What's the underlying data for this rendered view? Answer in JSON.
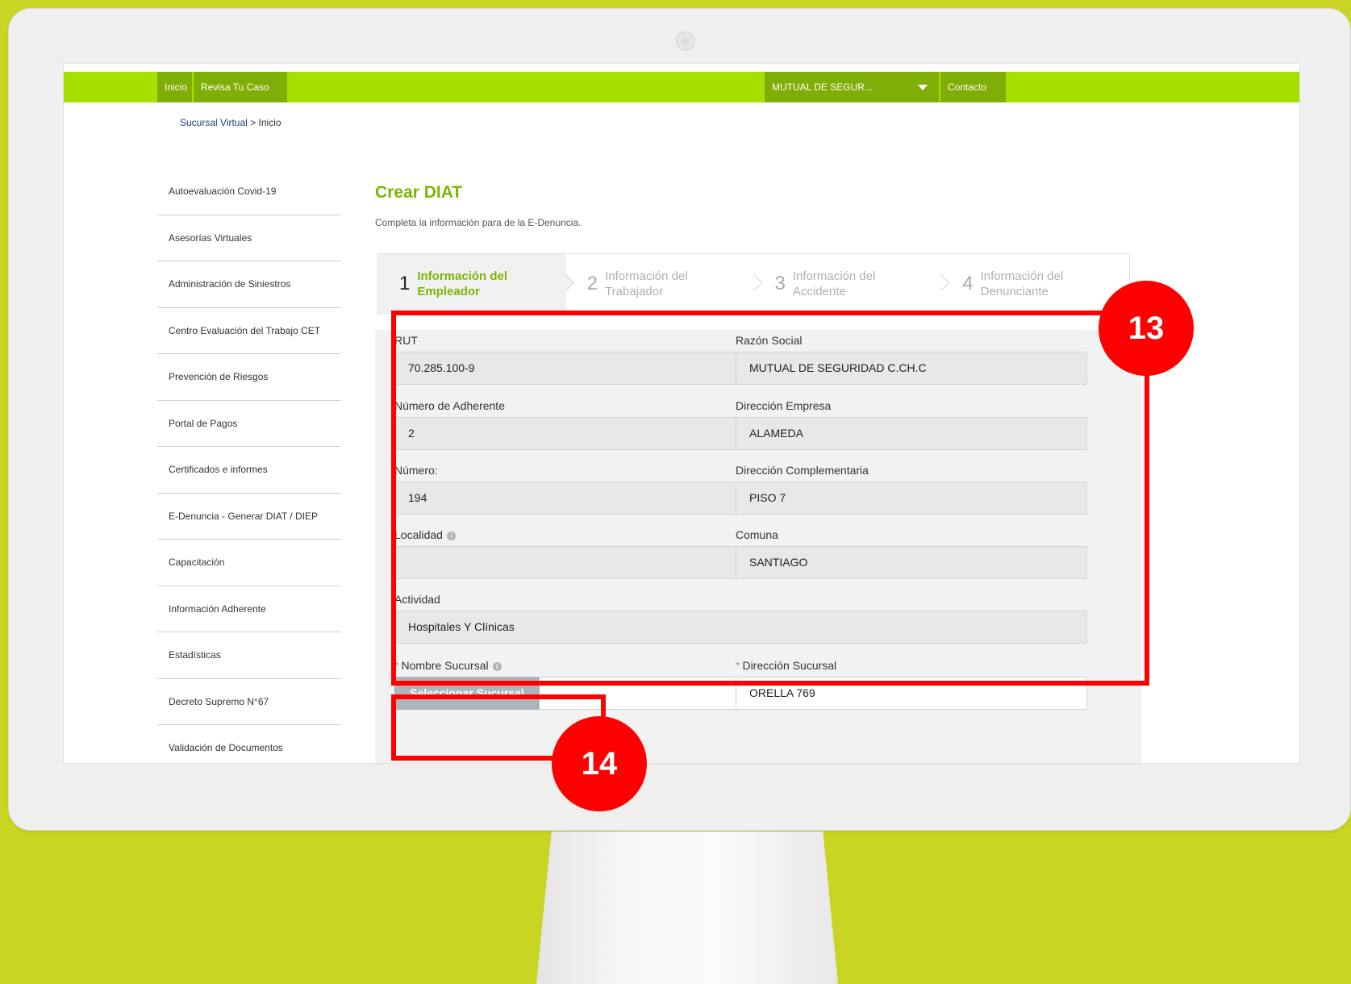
{
  "nav": {
    "inicio": "Inicio",
    "revisa": "Revisa Tu Caso",
    "company": "MUTUAL DE SEGUR...",
    "contacto": "Contacto"
  },
  "breadcrumb": {
    "link": "Sucursal Virtual",
    "separator": " > ",
    "current": "Inicio"
  },
  "sidebar": {
    "items": [
      {
        "label": "Autoevaluación Covid-19"
      },
      {
        "label": "Asesorías Virtuales"
      },
      {
        "label": "Administración de Siniestros"
      },
      {
        "label": "Centro Evaluación del Trabajo CET"
      },
      {
        "label": "Prevención de Riesgos"
      },
      {
        "label": "Portal de Pagos"
      },
      {
        "label": "Certificados e informes"
      },
      {
        "label": "E-Denuncia - Generar DIAT / DIEP"
      },
      {
        "label": "Capacitación"
      },
      {
        "label": "Información Adherente"
      },
      {
        "label": "Estadísticas"
      },
      {
        "label": "Decreto Supremo N°67"
      },
      {
        "label": "Validación de Documentos"
      }
    ]
  },
  "page": {
    "title": "Crear DIAT",
    "description": "Completa la información para de la E-Denuncia."
  },
  "steps": [
    {
      "num": "1",
      "label": "Información del Empleador"
    },
    {
      "num": "2",
      "label": "Información del Trabajador"
    },
    {
      "num": "3",
      "label": "Información del Accidente"
    },
    {
      "num": "4",
      "label": "Información del Denunciante"
    }
  ],
  "form": {
    "rut": {
      "label": "RUT",
      "value": "70.285.100-9"
    },
    "razon_social": {
      "label": "Razón Social",
      "value": "MUTUAL DE SEGURIDAD C.CH.C"
    },
    "num_adherente": {
      "label": "Número de Adherente",
      "value": "2"
    },
    "direccion_empresa": {
      "label": "Dirección Empresa",
      "value": "ALAMEDA"
    },
    "numero": {
      "label": "Número:",
      "value": "194"
    },
    "direccion_complementaria": {
      "label": "Dirección Complementaria",
      "value": "PISO 7"
    },
    "localidad": {
      "label": "Localidad",
      "value": ""
    },
    "comuna": {
      "label": "Comuna",
      "value": "SANTIAGO"
    },
    "actividad": {
      "label": "Actividad",
      "value": "Hospitales Y Clínicas"
    },
    "nombre_sucursal": {
      "label": "Nombre Sucursal",
      "button": "Seleccionar Sucursal"
    },
    "direccion_sucursal": {
      "label": "Dirección Sucursal",
      "value": "ORELLA  769"
    },
    "required_mark": "*",
    "info_glyph": "i"
  },
  "annotations": {
    "badge_13": "13",
    "badge_14": "14"
  },
  "colors": {
    "background": "#cad422",
    "nav_green": "#a6e000",
    "nav_item": "#7fae06",
    "accent": "#7cb503",
    "highlight": "#ff0000"
  }
}
